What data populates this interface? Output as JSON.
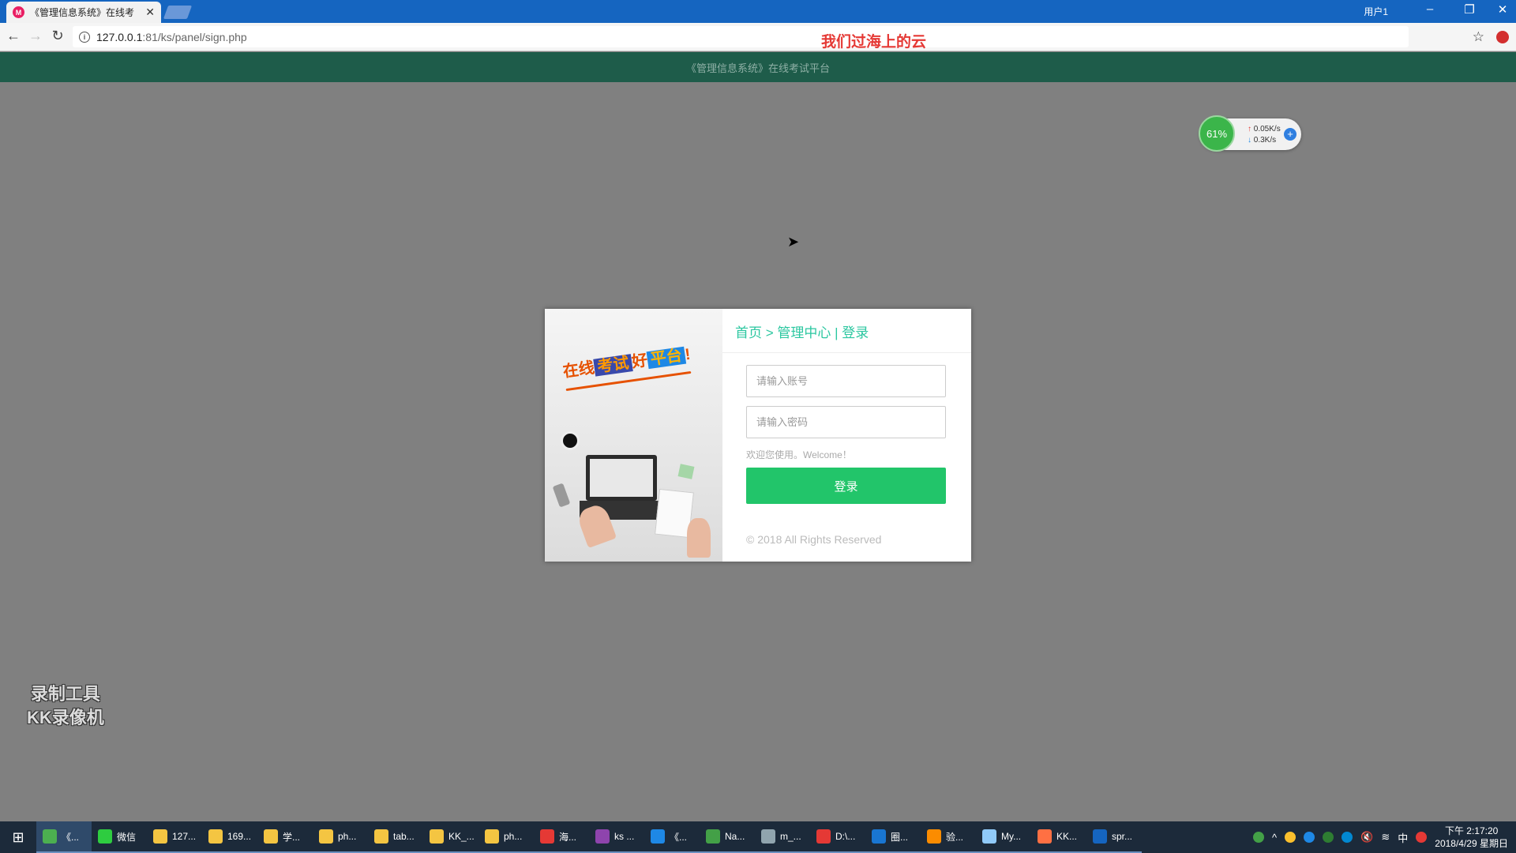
{
  "browser": {
    "tab_title": "《管理信息系统》在线考",
    "tab_favicon": "M",
    "user_label": "用户1",
    "url_host": "127.0.0.1",
    "url_path": ":81/ks/panel/sign.php",
    "overlay_text": "我们过海上的云"
  },
  "page": {
    "header_title": "《管理信息系统》在线考试平台"
  },
  "net_widget": {
    "percent": "61%",
    "up": "0.05K/s",
    "down": "0.3K/s"
  },
  "login": {
    "slogan_part1": "在线",
    "slogan_part2": "考试",
    "slogan_part3": "好",
    "slogan_part4": "平台",
    "slogan_part5": "!",
    "breadcrumb": "首页 > 管理中心 | 登录",
    "account_placeholder": "请输入账号",
    "password_placeholder": "请输入密码",
    "welcome": "欢迎您使用。Welcome！",
    "submit_label": "登录",
    "copyright": "© 2018 All Rights Reserved"
  },
  "watermark": {
    "line1": "录制工具",
    "line2": "KK录像机"
  },
  "taskbar": {
    "items": [
      {
        "label": "《...",
        "color": "#4caf50"
      },
      {
        "label": "微信",
        "color": "#2ecc40"
      },
      {
        "label": "127...",
        "color": "#f4c542"
      },
      {
        "label": "169...",
        "color": "#f4c542"
      },
      {
        "label": "学...",
        "color": "#f4c542"
      },
      {
        "label": "ph...",
        "color": "#f4c542"
      },
      {
        "label": "tab...",
        "color": "#f4c542"
      },
      {
        "label": "KK_...",
        "color": "#f4c542"
      },
      {
        "label": "ph...",
        "color": "#f4c542"
      },
      {
        "label": "海...",
        "color": "#e53935"
      },
      {
        "label": "ks ...",
        "color": "#8e44ad"
      },
      {
        "label": "《...",
        "color": "#1e88e5"
      },
      {
        "label": "Na...",
        "color": "#43a047"
      },
      {
        "label": "m_...",
        "color": "#90a4ae"
      },
      {
        "label": "D:\\...",
        "color": "#e53935"
      },
      {
        "label": "圈...",
        "color": "#1976d2"
      },
      {
        "label": "验...",
        "color": "#fb8c00"
      },
      {
        "label": "My...",
        "color": "#90caf9"
      },
      {
        "label": "KK...",
        "color": "#ff7043"
      },
      {
        "label": "spr...",
        "color": "#1565c0"
      }
    ],
    "ime": "中",
    "time": "下午 2:17:20",
    "date": "2018/4/29 星期日"
  }
}
